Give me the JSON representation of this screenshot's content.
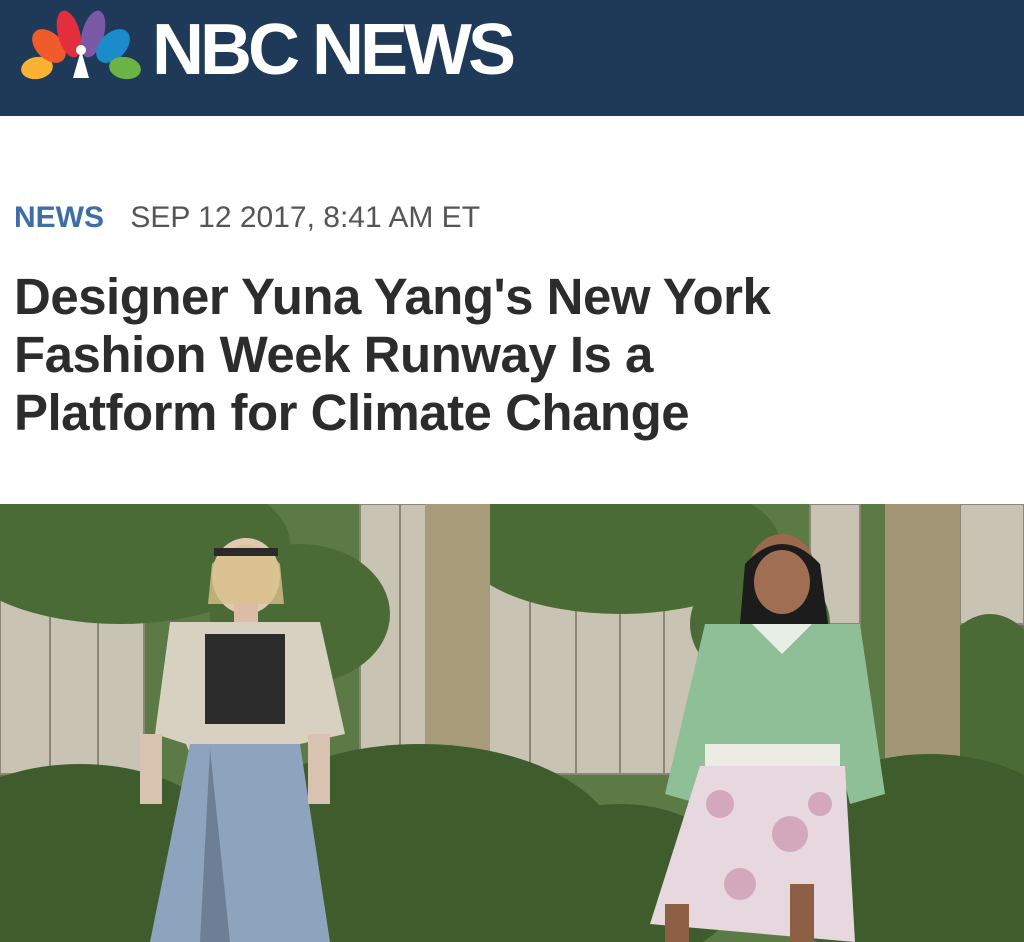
{
  "header": {
    "brand": "NBC NEWS",
    "logo_icon": "nbc-peacock-icon",
    "background": "#1f3a58"
  },
  "article": {
    "category": "NEWS",
    "timestamp": "SEP 12 2017, 8:41 AM ET",
    "headline_lines": [
      "Designer Yuna Yang's New York",
      "Fashion Week Runway Is a",
      "Platform for Climate Change"
    ]
  },
  "colors": {
    "category": "#3f6da6",
    "headline": "#2c2c2c",
    "meta": "#555555"
  }
}
